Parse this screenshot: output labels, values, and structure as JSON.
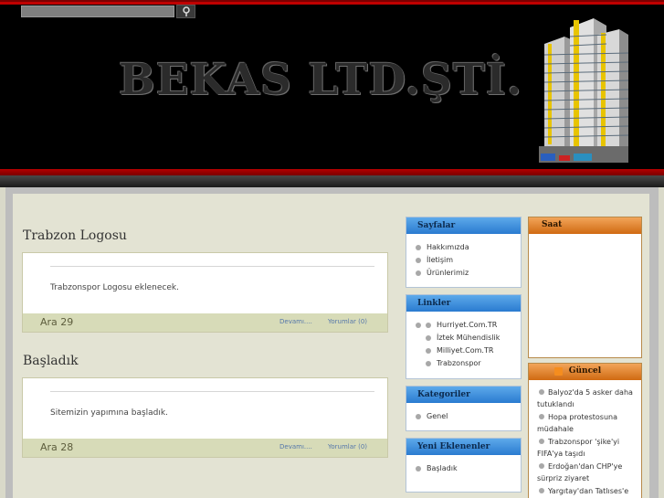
{
  "header": {
    "logo_text": "BEKAS LTD.ŞTİ.",
    "search": {
      "placeholder": ""
    }
  },
  "posts": [
    {
      "title": "Trabzon Logosu",
      "body": "Trabzonspor Logosu eklenecek.",
      "date": "Ara 29",
      "more_label": "Devamı....",
      "comments_label": "Yorumlar (0)"
    },
    {
      "title": "Başladık",
      "body": "Sitemizin yapımına başladık.",
      "date": "Ara 28",
      "more_label": "Devamı....",
      "comments_label": "Yorumlar (0)"
    }
  ],
  "sidebar": {
    "sayfalar": {
      "title": "Sayfalar",
      "items": [
        "Hakkımızda",
        "İletişim",
        "Ürünlerimiz"
      ]
    },
    "linkler": {
      "title": "Linkler",
      "items": [
        "Hurriyet.Com.TR",
        "İztek Mühendislik",
        "Milliyet.Com.TR",
        "Trabzonspor"
      ]
    },
    "kategoriler": {
      "title": "Kategoriler",
      "items": [
        "Genel"
      ]
    },
    "yeni": {
      "title": "Yeni Eklenenler",
      "items": [
        "Başladık"
      ]
    }
  },
  "right": {
    "saat": {
      "title": "Saat"
    },
    "guncel": {
      "title": "Güncel",
      "items": [
        {
          "a": "Balyoz'da 5 asker daha",
          "b": "tutuklandı"
        },
        {
          "a": "Hopa protestosuna",
          "b": "müdahale"
        },
        {
          "a": "Trabzonspor 'şike'yi",
          "b": "FIFA'ya taşıdı"
        },
        {
          "a": "Erdoğan'dan CHP'ye",
          "b": "sürpriz ziyaret"
        },
        {
          "a": "Yargıtay'dan Tatlıses'e",
          "b": ""
        }
      ]
    }
  },
  "colors": {
    "header_bg": "#000000",
    "red_band": "#b40000",
    "widget_blue": "#2a7bd0",
    "widget_orange": "#d06a12",
    "page_bg": "#e3e3d3"
  },
  "icons": [
    "search-icon",
    "rss-icon",
    "bullet-icon"
  ]
}
